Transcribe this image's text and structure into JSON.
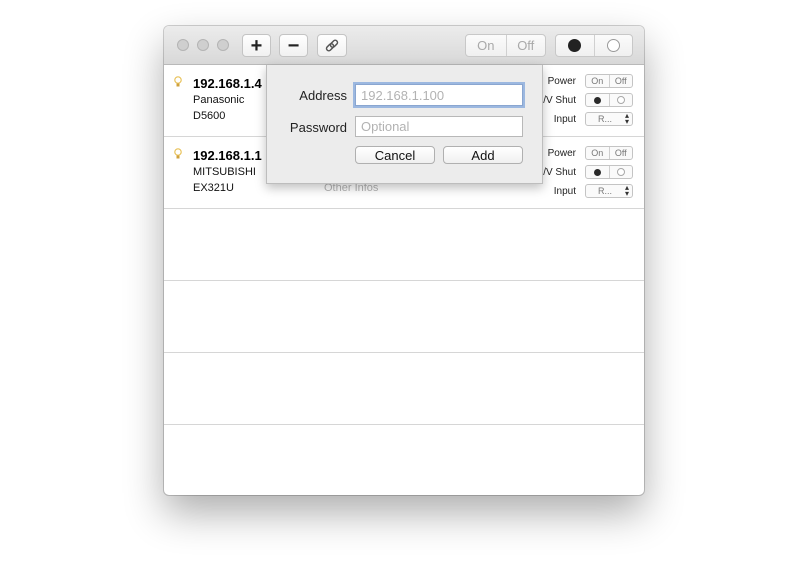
{
  "toolbar": {
    "add_label": "+",
    "remove_label": "−",
    "link_icon": "link-icon",
    "on_label": "On",
    "off_label": "Off"
  },
  "devices": [
    {
      "ip": "192.168.1.4",
      "vendor": "Panasonic",
      "model": "D5600",
      "other_info": "",
      "power_label": "Power",
      "power_on": "On",
      "power_off": "Off",
      "shutter_label": "/V Shut",
      "input_label": "Input",
      "input_value": "R..."
    },
    {
      "ip": "192.168.1.1",
      "vendor": "MITSUBISHI",
      "model": "EX321U",
      "other_info": "Other Infos",
      "power_label": "Power",
      "power_on": "On",
      "power_off": "Off",
      "shutter_label": "/V Shut",
      "input_label": "Input",
      "input_value": "R..."
    }
  ],
  "dialog": {
    "address_label": "Address",
    "address_placeholder": "192.168.1.100",
    "password_label": "Password",
    "password_placeholder": "Optional",
    "cancel_label": "Cancel",
    "add_label": "Add"
  },
  "colors": {
    "focus_ring": "#9cb8e0",
    "bulb": "#e8c25a"
  }
}
